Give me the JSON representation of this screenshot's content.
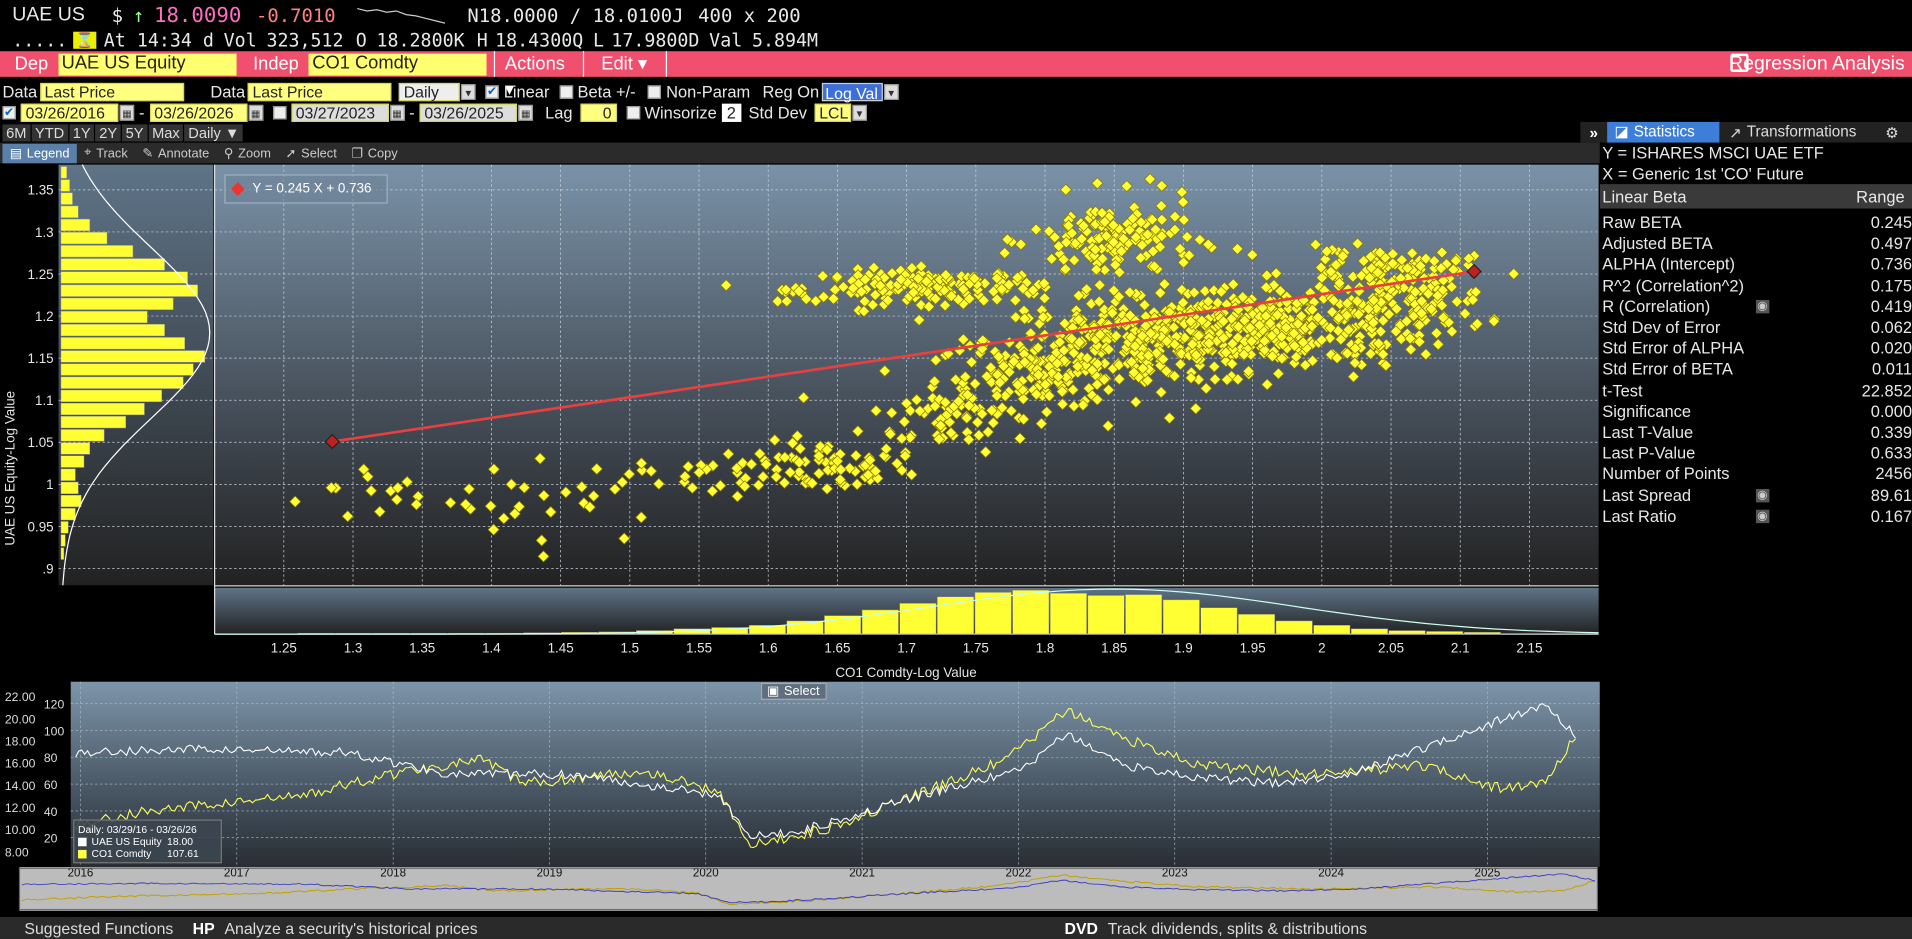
{
  "quote": {
    "ticker": "UAE US",
    "currency": "$",
    "arrow": "↑",
    "last": "18.0090",
    "change": "-0.7010",
    "bid_ask": "N18.0000 / 18.0100J",
    "size": "400 x 200",
    "dots": ".....",
    "hour_icon": "⌛",
    "time": "At  14:34 d",
    "vol_label": "Vol",
    "vol": "323,512",
    "open_label": "O",
    "open": "18.2800K",
    "high_label": "H",
    "high": "18.4300Q",
    "low_label": "L",
    "low": "17.9800D",
    "val_label": "Val",
    "val": "5.894M"
  },
  "menubar": {
    "dep_label": "Dep",
    "dep_value": "UAE US Equity",
    "indep_label": "Indep",
    "indep_value": "CO1 Comdty",
    "actions": "Actions ▾",
    "edit": "Edit ▾",
    "title": "Regression Analysis"
  },
  "settings": {
    "data1_label": "Data",
    "data1_value": "Last Price",
    "data2_label": "Data",
    "data2_value": "Last Price",
    "period": "Daily",
    "linear": "Linear",
    "beta": "Beta +/-",
    "nonparam": "Non-Param",
    "regon_label": "Reg On",
    "regon_value": "Log Val",
    "d1": "03/26/2016",
    "d2": "03/26/2026",
    "d3": "03/27/2023",
    "d4": "03/26/2025",
    "sep": "-",
    "lag_label": "Lag",
    "lag_value": "0",
    "winsorize": "Winsorize",
    "wins_value": "2",
    "stddev_label": "Std Dev",
    "stddev_value": "LCL"
  },
  "range_tabs": [
    "6M",
    "YTD",
    "1Y",
    "2Y",
    "5Y",
    "Max"
  ],
  "range_period": "Daily ▼",
  "panel_tabs": {
    "stats": "Statistics",
    "transforms": "Transformations"
  },
  "toolbar": [
    "Legend",
    "Track",
    "Annotate",
    "Zoom",
    "Select",
    "Copy"
  ],
  "stats": {
    "y_label": "Y = ISHARES MSCI UAE ETF",
    "x_label": "X = Generic 1st 'CO' Future",
    "header_left": "Linear Beta",
    "header_right": "Range",
    "rows": [
      {
        "label": "Raw BETA",
        "value": "0.245",
        "icon": false
      },
      {
        "label": "Adjusted BETA",
        "value": "0.497",
        "icon": false
      },
      {
        "label": "ALPHA (Intercept)",
        "value": "0.736",
        "icon": false
      },
      {
        "label": "R^2 (Correlation^2)",
        "value": "0.175",
        "icon": false
      },
      {
        "label": "R (Correlation)",
        "value": "0.419",
        "icon": true
      },
      {
        "label": "Std Dev of Error",
        "value": "0.062",
        "icon": false
      },
      {
        "label": "Std Error of ALPHA",
        "value": "0.020",
        "icon": false
      },
      {
        "label": "Std Error of BETA",
        "value": "0.011",
        "icon": false
      },
      {
        "label": "t-Test",
        "value": "22.852",
        "icon": false
      },
      {
        "label": "Significance",
        "value": "0.000",
        "icon": false
      },
      {
        "label": "Last T-Value",
        "value": "0.339",
        "icon": false
      },
      {
        "label": "Last P-Value",
        "value": "0.633",
        "icon": false
      },
      {
        "label": "Number of Points",
        "value": "2456",
        "icon": false
      },
      {
        "label": "Last Spread",
        "value": "89.61",
        "icon": true
      },
      {
        "label": "Last Ratio",
        "value": "0.167",
        "icon": true
      }
    ]
  },
  "scatter": {
    "legend": "Y = 0.245 X + 0.736",
    "xlabel": "CO1 Comdty-Log Value",
    "ylabel": "UAE US Equity-Log Value",
    "xticks": [
      "1.25",
      "1.3",
      "1.35",
      "1.4",
      "1.45",
      "1.5",
      "1.55",
      "1.6",
      "1.65",
      "1.7",
      "1.75",
      "1.8",
      "1.85",
      "1.9",
      "1.95",
      "2",
      "2.05",
      "2.1",
      "2.15"
    ],
    "yticks": [
      "1.35",
      "1.3",
      "1.25",
      "1.2",
      "1.15",
      "1.1",
      "1.05",
      "1",
      "0.95",
      ".9"
    ]
  },
  "chart_data": {
    "type": "scatter",
    "xlim": [
      1.2,
      2.2
    ],
    "ylim": [
      0.88,
      1.38
    ],
    "regression": {
      "slope": 0.245,
      "intercept": 0.736,
      "x_from": 1.285,
      "x_to": 2.11
    },
    "clusters": [
      {
        "cx": 1.32,
        "cy": 0.99,
        "sx": 0.03,
        "sy": 0.02,
        "n": 14
      },
      {
        "cx": 1.45,
        "cy": 0.98,
        "sx": 0.04,
        "sy": 0.025,
        "n": 30
      },
      {
        "cx": 1.56,
        "cy": 1.01,
        "sx": 0.025,
        "sy": 0.012,
        "n": 20
      },
      {
        "cx": 1.64,
        "cy": 1.02,
        "sx": 0.03,
        "sy": 0.015,
        "n": 70
      },
      {
        "cx": 1.73,
        "cy": 1.08,
        "sx": 0.03,
        "sy": 0.02,
        "n": 60
      },
      {
        "cx": 1.8,
        "cy": 1.13,
        "sx": 0.04,
        "sy": 0.02,
        "n": 140
      },
      {
        "cx": 1.88,
        "cy": 1.17,
        "sx": 0.06,
        "sy": 0.025,
        "n": 320
      },
      {
        "cx": 1.97,
        "cy": 1.19,
        "sx": 0.05,
        "sy": 0.025,
        "n": 260
      },
      {
        "cx": 2.06,
        "cy": 1.22,
        "sx": 0.03,
        "sy": 0.025,
        "n": 130
      },
      {
        "cx": 1.72,
        "cy": 1.235,
        "sx": 0.04,
        "sy": 0.01,
        "n": 160
      },
      {
        "cx": 1.62,
        "cy": 1.225,
        "sx": 0.01,
        "sy": 0.006,
        "n": 10
      },
      {
        "cx": 1.85,
        "cy": 1.29,
        "sx": 0.03,
        "sy": 0.025,
        "n": 150
      },
      {
        "cx": 2.04,
        "cy": 1.26,
        "sx": 0.03,
        "sy": 0.01,
        "n": 60
      }
    ],
    "hist_x": [
      0.02,
      0.02,
      0.02,
      0.02,
      0.02,
      0.02,
      0.03,
      0.04,
      0.05,
      0.08,
      0.12,
      0.15,
      0.2,
      0.3,
      0.42,
      0.55,
      0.7,
      0.85,
      0.95,
      1.0,
      0.93,
      0.88,
      0.9,
      0.78,
      0.6,
      0.45,
      0.3,
      0.2,
      0.12,
      0.08,
      0.06,
      0.04
    ],
    "hist_y": [
      0.02,
      0.03,
      0.05,
      0.1,
      0.14,
      0.12,
      0.1,
      0.16,
      0.2,
      0.3,
      0.45,
      0.58,
      0.7,
      0.85,
      0.92,
      1.0,
      0.86,
      0.72,
      0.6,
      0.78,
      0.95,
      0.88,
      0.72,
      0.5,
      0.32,
      0.2,
      0.12,
      0.08,
      0.06,
      0.04
    ]
  },
  "timeseries": {
    "select": "Select",
    "left_ticks": [
      "22.00",
      "20.00",
      "18.00",
      "16.00",
      "14.00",
      "12.00",
      "10.00",
      "8.00"
    ],
    "right_ticks": [
      "120",
      "100",
      "80",
      "60",
      "40",
      "20"
    ],
    "legend_title": "Daily: 03/29/16 - 03/26/26",
    "series": [
      {
        "name": "UAE US Equity",
        "value": "18.00",
        "color": "#ffffff"
      },
      {
        "name": "CO1 Comdty",
        "value": "107.61",
        "color": "#ffff44"
      }
    ],
    "years": [
      "2016",
      "2017",
      "2018",
      "2019",
      "2020",
      "2021",
      "2022",
      "2023",
      "2024",
      "2025",
      "2026"
    ]
  },
  "footer": {
    "left": "Suggested Functions",
    "hp_code": "HP",
    "hp_text": "Analyze a security's historical prices",
    "dvd_code": "DVD",
    "dvd_text": "Track dividends, splits & distributions"
  },
  "colors": {
    "accent": "#f0506e",
    "input_bg": "#ffff80",
    "point": "#ffff33",
    "regression": "#e84040",
    "tab_active": "#3d7fd8"
  }
}
